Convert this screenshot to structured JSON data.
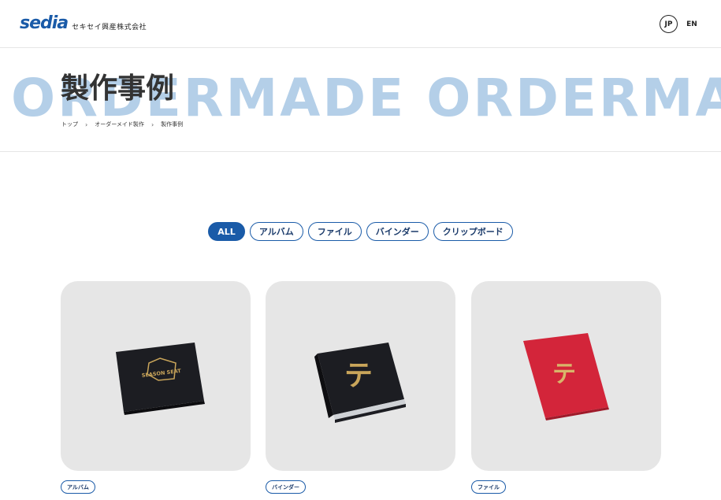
{
  "header": {
    "logo_mark": "sedia",
    "logo_company": "セキセイ興産株式会社",
    "lang_jp": "JP",
    "lang_en": "EN"
  },
  "hero": {
    "background_word": "ORDERMADE ORDERMADE",
    "title": "製作事例",
    "breadcrumb": [
      "トップ",
      "オーダーメイド製作",
      "製作事例"
    ],
    "breadcrumb_separator": "›"
  },
  "filters": [
    {
      "label": "ALL",
      "active": true
    },
    {
      "label": "アルバム",
      "active": false
    },
    {
      "label": "ファイル",
      "active": false
    },
    {
      "label": "バインダー",
      "active": false
    },
    {
      "label": "クリップボード",
      "active": false
    }
  ],
  "cards": [
    {
      "tag": "アルバム",
      "product_text": "SEASON SEAT",
      "icon": "black-album-icon"
    },
    {
      "tag": "バインダー",
      "product_text": "テ",
      "icon": "black-binder-icon"
    },
    {
      "tag": "ファイル",
      "product_text": "テ",
      "icon": "red-file-icon"
    }
  ],
  "colors": {
    "brand_blue": "#1a5ba8",
    "bg_word": "#b4cfe8",
    "card_bg": "#e6e6e6",
    "gold": "#c9a55a",
    "red_file": "#d3253a"
  }
}
